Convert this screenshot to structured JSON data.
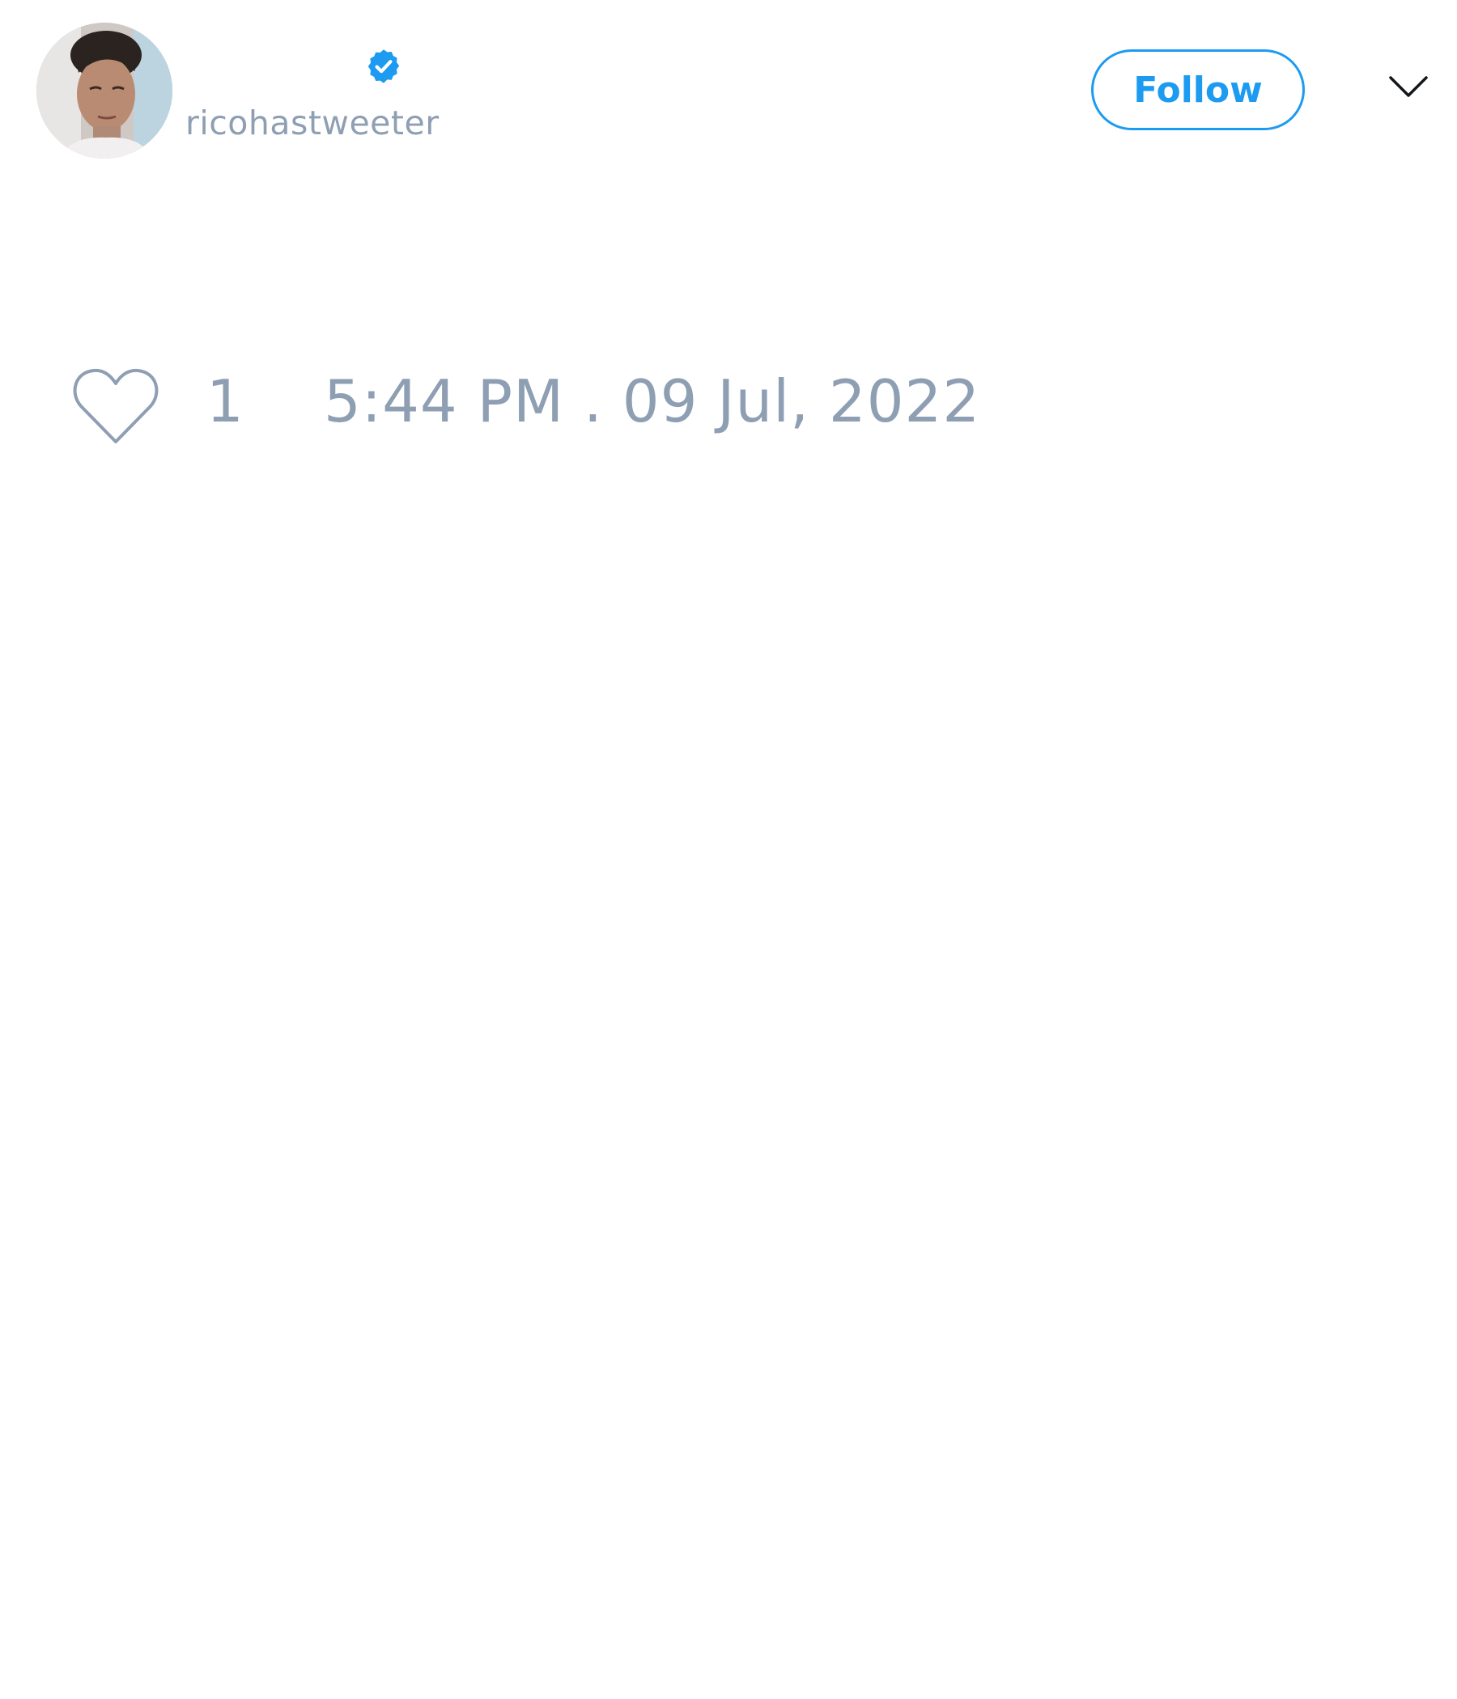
{
  "author": {
    "display_name": "",
    "handle": "ricohastweeter",
    "verified": true,
    "avatar_icon": "profile-photo"
  },
  "header": {
    "follow_label": "Follow",
    "menu_icon": "chevron-down-icon"
  },
  "engagement": {
    "like_icon": "heart-outline-icon",
    "like_count": "1",
    "timestamp": "5:44 PM . 09 Jul, 2022"
  },
  "colors": {
    "accent": "#1d9bf0",
    "muted_text": "#8f9fb3",
    "background": "#ffffff"
  }
}
